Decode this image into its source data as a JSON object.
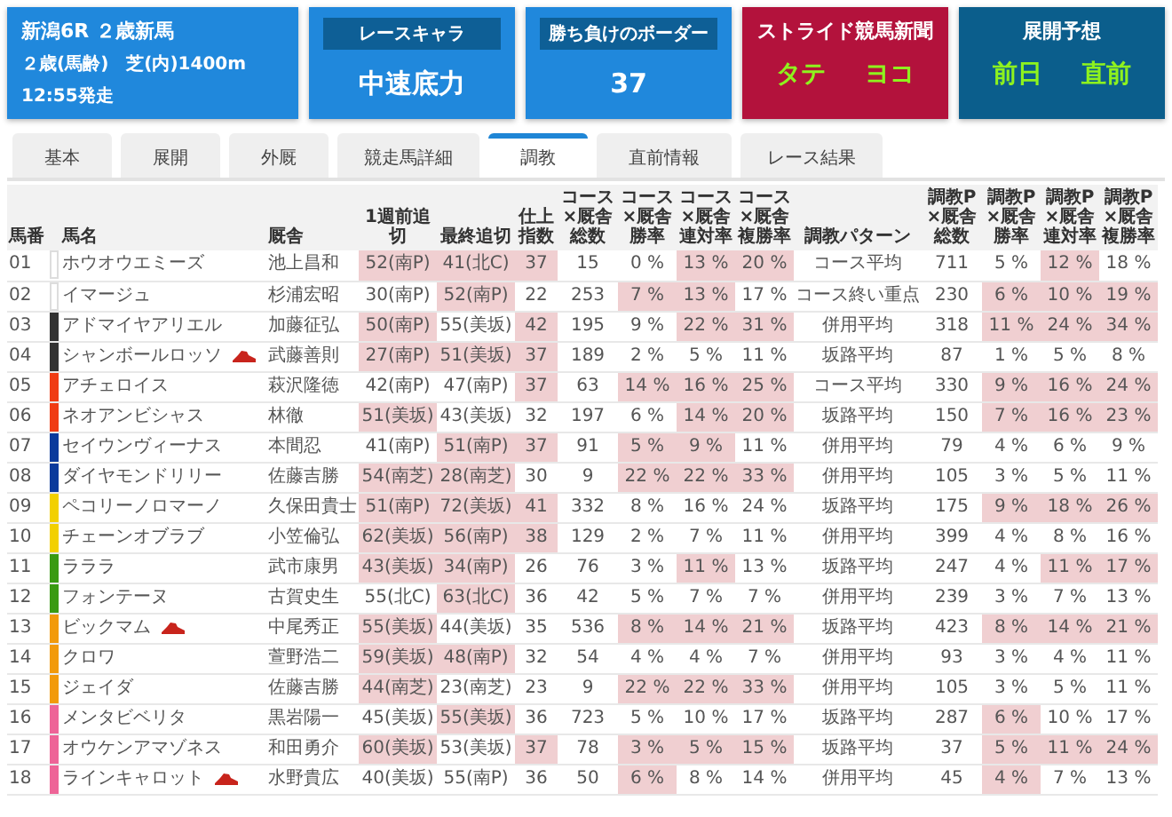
{
  "header_cards": [
    {
      "kind": "race",
      "color": "#2088dc",
      "title": "新潟6R ２歳新馬",
      "details": [
        "２歳(馬齢)",
        "芝(内)1400m"
      ],
      "time": "12:55発走"
    },
    {
      "kind": "metric",
      "color": "#2088dc",
      "label": "レースキャラ",
      "value": "中速底力"
    },
    {
      "kind": "metric",
      "color": "#2088dc",
      "label": "勝ち負けのボーダー",
      "value": "37"
    },
    {
      "kind": "pair",
      "color": "#b3123c",
      "title": "ストライド競馬新聞",
      "values": [
        "タテ",
        "ヨコ"
      ]
    },
    {
      "kind": "pair",
      "color": "#0b5e8c",
      "title": "展開予想",
      "values": [
        "前日",
        "直前"
      ]
    }
  ],
  "tabs": [
    {
      "label": "基本",
      "selected": false
    },
    {
      "label": "展開",
      "selected": false
    },
    {
      "label": "外厩",
      "selected": false
    },
    {
      "label": "競走馬詳細",
      "selected": false
    },
    {
      "label": "調教",
      "selected": true
    },
    {
      "label": "直前情報",
      "selected": false
    },
    {
      "label": "レース結果",
      "selected": false
    }
  ],
  "table": {
    "columns": [
      "馬番",
      "馬名",
      "厩舎",
      "1週前追切",
      "最終追切",
      "仕上指数",
      "コース×厩舎総数",
      "コース×厩舎勝率",
      "コース×厩舎連対率",
      "コース×厩舎複勝率",
      "調教パターン",
      "調教P×厩舎総数",
      "調教P×厩舎勝率",
      "調教P×厩舎連対率",
      "調教P×厩舎複勝率"
    ],
    "rows": [
      {
        "color": "#ffffff",
        "flagged": false,
        "cells": [
          {
            "text": "01",
            "highlighted": false
          },
          {
            "text": "ホウオウエミーズ",
            "highlighted": false
          },
          {
            "text": "池上昌和",
            "highlighted": false
          },
          {
            "text": "52(南P)",
            "highlighted": true
          },
          {
            "text": "41(北C)",
            "highlighted": true
          },
          {
            "text": "37",
            "highlighted": true
          },
          {
            "text": "15",
            "highlighted": false
          },
          {
            "text": "0 %",
            "highlighted": false
          },
          {
            "text": "13 %",
            "highlighted": true
          },
          {
            "text": "20 %",
            "highlighted": true
          },
          {
            "text": "コース平均",
            "highlighted": false
          },
          {
            "text": "711",
            "highlighted": false
          },
          {
            "text": "5 %",
            "highlighted": false
          },
          {
            "text": "12 %",
            "highlighted": true
          },
          {
            "text": "18 %",
            "highlighted": false
          }
        ]
      },
      {
        "color": "#ffffff",
        "flagged": false,
        "cells": [
          {
            "text": "02",
            "highlighted": false
          },
          {
            "text": "イマージュ",
            "highlighted": false
          },
          {
            "text": "杉浦宏昭",
            "highlighted": false
          },
          {
            "text": "30(南P)",
            "highlighted": false
          },
          {
            "text": "52(南P)",
            "highlighted": true
          },
          {
            "text": "22",
            "highlighted": false
          },
          {
            "text": "253",
            "highlighted": false
          },
          {
            "text": "7 %",
            "highlighted": true
          },
          {
            "text": "13 %",
            "highlighted": true
          },
          {
            "text": "17 %",
            "highlighted": false
          },
          {
            "text": "コース終い重点",
            "highlighted": false
          },
          {
            "text": "230",
            "highlighted": false
          },
          {
            "text": "6 %",
            "highlighted": true
          },
          {
            "text": "10 %",
            "highlighted": true
          },
          {
            "text": "19 %",
            "highlighted": true
          }
        ]
      },
      {
        "color": "#333333",
        "flagged": false,
        "cells": [
          {
            "text": "03",
            "highlighted": false
          },
          {
            "text": "アドマイヤアリエル",
            "highlighted": false
          },
          {
            "text": "加藤征弘",
            "highlighted": false
          },
          {
            "text": "50(南P)",
            "highlighted": true
          },
          {
            "text": "55(美坂)",
            "highlighted": false
          },
          {
            "text": "42",
            "highlighted": true
          },
          {
            "text": "195",
            "highlighted": false
          },
          {
            "text": "9 %",
            "highlighted": false
          },
          {
            "text": "22 %",
            "highlighted": true
          },
          {
            "text": "31 %",
            "highlighted": true
          },
          {
            "text": "併用平均",
            "highlighted": false
          },
          {
            "text": "318",
            "highlighted": false
          },
          {
            "text": "11 %",
            "highlighted": true
          },
          {
            "text": "24 %",
            "highlighted": true
          },
          {
            "text": "34 %",
            "highlighted": true
          }
        ]
      },
      {
        "color": "#333333",
        "flagged": true,
        "cells": [
          {
            "text": "04",
            "highlighted": false
          },
          {
            "text": "シャンボールロッソ",
            "highlighted": false
          },
          {
            "text": "武藤善則",
            "highlighted": false
          },
          {
            "text": "27(南P)",
            "highlighted": true
          },
          {
            "text": "51(美坂)",
            "highlighted": true
          },
          {
            "text": "37",
            "highlighted": true
          },
          {
            "text": "189",
            "highlighted": false
          },
          {
            "text": "2 %",
            "highlighted": false
          },
          {
            "text": "5 %",
            "highlighted": false
          },
          {
            "text": "11 %",
            "highlighted": false
          },
          {
            "text": "坂路平均",
            "highlighted": false
          },
          {
            "text": "87",
            "highlighted": false
          },
          {
            "text": "1 %",
            "highlighted": false
          },
          {
            "text": "5 %",
            "highlighted": false
          },
          {
            "text": "8 %",
            "highlighted": false
          }
        ]
      },
      {
        "color": "#f03c14",
        "flagged": false,
        "cells": [
          {
            "text": "05",
            "highlighted": false
          },
          {
            "text": "アチェロイス",
            "highlighted": false
          },
          {
            "text": "萩沢隆徳",
            "highlighted": false
          },
          {
            "text": "42(南P)",
            "highlighted": false
          },
          {
            "text": "47(南P)",
            "highlighted": false
          },
          {
            "text": "37",
            "highlighted": true
          },
          {
            "text": "63",
            "highlighted": false
          },
          {
            "text": "14 %",
            "highlighted": true
          },
          {
            "text": "16 %",
            "highlighted": true
          },
          {
            "text": "25 %",
            "highlighted": true
          },
          {
            "text": "コース平均",
            "highlighted": false
          },
          {
            "text": "330",
            "highlighted": false
          },
          {
            "text": "9 %",
            "highlighted": true
          },
          {
            "text": "16 %",
            "highlighted": true
          },
          {
            "text": "24 %",
            "highlighted": true
          }
        ]
      },
      {
        "color": "#f03c14",
        "flagged": false,
        "cells": [
          {
            "text": "06",
            "highlighted": false
          },
          {
            "text": "ネオアンビシャス",
            "highlighted": false
          },
          {
            "text": "林徹",
            "highlighted": false
          },
          {
            "text": "51(美坂)",
            "highlighted": true
          },
          {
            "text": "43(美坂)",
            "highlighted": false
          },
          {
            "text": "32",
            "highlighted": false
          },
          {
            "text": "197",
            "highlighted": false
          },
          {
            "text": "6 %",
            "highlighted": false
          },
          {
            "text": "14 %",
            "highlighted": true
          },
          {
            "text": "20 %",
            "highlighted": true
          },
          {
            "text": "坂路平均",
            "highlighted": false
          },
          {
            "text": "150",
            "highlighted": false
          },
          {
            "text": "7 %",
            "highlighted": true
          },
          {
            "text": "16 %",
            "highlighted": true
          },
          {
            "text": "23 %",
            "highlighted": true
          }
        ]
      },
      {
        "color": "#0b3a9c",
        "flagged": false,
        "cells": [
          {
            "text": "07",
            "highlighted": false
          },
          {
            "text": "セイウンヴィーナス",
            "highlighted": false
          },
          {
            "text": "本間忍",
            "highlighted": false
          },
          {
            "text": "41(南P)",
            "highlighted": false
          },
          {
            "text": "51(南P)",
            "highlighted": true
          },
          {
            "text": "37",
            "highlighted": true
          },
          {
            "text": "91",
            "highlighted": false
          },
          {
            "text": "5 %",
            "highlighted": true
          },
          {
            "text": "9 %",
            "highlighted": true
          },
          {
            "text": "11 %",
            "highlighted": false
          },
          {
            "text": "併用平均",
            "highlighted": false
          },
          {
            "text": "79",
            "highlighted": false
          },
          {
            "text": "4 %",
            "highlighted": false
          },
          {
            "text": "6 %",
            "highlighted": false
          },
          {
            "text": "9 %",
            "highlighted": false
          }
        ]
      },
      {
        "color": "#0b3a9c",
        "flagged": false,
        "cells": [
          {
            "text": "08",
            "highlighted": false
          },
          {
            "text": "ダイヤモンドリリー",
            "highlighted": false
          },
          {
            "text": "佐藤吉勝",
            "highlighted": false
          },
          {
            "text": "54(南芝)",
            "highlighted": true
          },
          {
            "text": "28(南芝)",
            "highlighted": true
          },
          {
            "text": "30",
            "highlighted": false
          },
          {
            "text": "9",
            "highlighted": false
          },
          {
            "text": "22 %",
            "highlighted": true
          },
          {
            "text": "22 %",
            "highlighted": true
          },
          {
            "text": "33 %",
            "highlighted": true
          },
          {
            "text": "併用平均",
            "highlighted": false
          },
          {
            "text": "105",
            "highlighted": false
          },
          {
            "text": "3 %",
            "highlighted": false
          },
          {
            "text": "5 %",
            "highlighted": false
          },
          {
            "text": "11 %",
            "highlighted": false
          }
        ]
      },
      {
        "color": "#f2d000",
        "flagged": false,
        "cells": [
          {
            "text": "09",
            "highlighted": false
          },
          {
            "text": "ペコリーノロマーノ",
            "highlighted": false
          },
          {
            "text": "久保田貴士",
            "highlighted": false
          },
          {
            "text": "51(南P)",
            "highlighted": true
          },
          {
            "text": "72(美坂)",
            "highlighted": true
          },
          {
            "text": "41",
            "highlighted": true
          },
          {
            "text": "332",
            "highlighted": false
          },
          {
            "text": "8 %",
            "highlighted": false
          },
          {
            "text": "16 %",
            "highlighted": false
          },
          {
            "text": "24 %",
            "highlighted": false
          },
          {
            "text": "坂路平均",
            "highlighted": false
          },
          {
            "text": "175",
            "highlighted": false
          },
          {
            "text": "9 %",
            "highlighted": true
          },
          {
            "text": "18 %",
            "highlighted": true
          },
          {
            "text": "26 %",
            "highlighted": true
          }
        ]
      },
      {
        "color": "#f2d000",
        "flagged": false,
        "cells": [
          {
            "text": "10",
            "highlighted": false
          },
          {
            "text": "チェーンオブラブ",
            "highlighted": false
          },
          {
            "text": "小笠倫弘",
            "highlighted": false
          },
          {
            "text": "62(美坂)",
            "highlighted": true
          },
          {
            "text": "56(南P)",
            "highlighted": true
          },
          {
            "text": "38",
            "highlighted": true
          },
          {
            "text": "129",
            "highlighted": false
          },
          {
            "text": "2 %",
            "highlighted": false
          },
          {
            "text": "7 %",
            "highlighted": false
          },
          {
            "text": "11 %",
            "highlighted": false
          },
          {
            "text": "併用平均",
            "highlighted": false
          },
          {
            "text": "399",
            "highlighted": false
          },
          {
            "text": "4 %",
            "highlighted": false
          },
          {
            "text": "8 %",
            "highlighted": false
          },
          {
            "text": "16 %",
            "highlighted": false
          }
        ]
      },
      {
        "color": "#3a9a12",
        "flagged": false,
        "cells": [
          {
            "text": "11",
            "highlighted": false
          },
          {
            "text": "ラララ",
            "highlighted": false
          },
          {
            "text": "武市康男",
            "highlighted": false
          },
          {
            "text": "43(美坂)",
            "highlighted": true
          },
          {
            "text": "34(南P)",
            "highlighted": true
          },
          {
            "text": "26",
            "highlighted": false
          },
          {
            "text": "76",
            "highlighted": false
          },
          {
            "text": "3 %",
            "highlighted": false
          },
          {
            "text": "11 %",
            "highlighted": true
          },
          {
            "text": "13 %",
            "highlighted": false
          },
          {
            "text": "坂路平均",
            "highlighted": false
          },
          {
            "text": "247",
            "highlighted": false
          },
          {
            "text": "4 %",
            "highlighted": false
          },
          {
            "text": "11 %",
            "highlighted": true
          },
          {
            "text": "17 %",
            "highlighted": true
          }
        ]
      },
      {
        "color": "#3a9a12",
        "flagged": false,
        "cells": [
          {
            "text": "12",
            "highlighted": false
          },
          {
            "text": "フォンテーヌ",
            "highlighted": false
          },
          {
            "text": "古賀史生",
            "highlighted": false
          },
          {
            "text": "55(北C)",
            "highlighted": false
          },
          {
            "text": "63(北C)",
            "highlighted": true
          },
          {
            "text": "36",
            "highlighted": false
          },
          {
            "text": "42",
            "highlighted": false
          },
          {
            "text": "5 %",
            "highlighted": false
          },
          {
            "text": "7 %",
            "highlighted": false
          },
          {
            "text": "7 %",
            "highlighted": false
          },
          {
            "text": "併用平均",
            "highlighted": false
          },
          {
            "text": "239",
            "highlighted": false
          },
          {
            "text": "3 %",
            "highlighted": false
          },
          {
            "text": "7 %",
            "highlighted": false
          },
          {
            "text": "13 %",
            "highlighted": false
          }
        ]
      },
      {
        "color": "#f29a0a",
        "flagged": true,
        "cells": [
          {
            "text": "13",
            "highlighted": false
          },
          {
            "text": "ビックマム",
            "highlighted": false
          },
          {
            "text": "中尾秀正",
            "highlighted": false
          },
          {
            "text": "55(美坂)",
            "highlighted": true
          },
          {
            "text": "44(美坂)",
            "highlighted": false
          },
          {
            "text": "35",
            "highlighted": false
          },
          {
            "text": "536",
            "highlighted": false
          },
          {
            "text": "8 %",
            "highlighted": true
          },
          {
            "text": "14 %",
            "highlighted": true
          },
          {
            "text": "21 %",
            "highlighted": true
          },
          {
            "text": "坂路平均",
            "highlighted": false
          },
          {
            "text": "423",
            "highlighted": false
          },
          {
            "text": "8 %",
            "highlighted": true
          },
          {
            "text": "14 %",
            "highlighted": true
          },
          {
            "text": "21 %",
            "highlighted": true
          }
        ]
      },
      {
        "color": "#f29a0a",
        "flagged": false,
        "cells": [
          {
            "text": "14",
            "highlighted": false
          },
          {
            "text": "クロワ",
            "highlighted": false
          },
          {
            "text": "萱野浩二",
            "highlighted": false
          },
          {
            "text": "59(美坂)",
            "highlighted": true
          },
          {
            "text": "48(南P)",
            "highlighted": true
          },
          {
            "text": "32",
            "highlighted": false
          },
          {
            "text": "54",
            "highlighted": false
          },
          {
            "text": "4 %",
            "highlighted": false
          },
          {
            "text": "4 %",
            "highlighted": false
          },
          {
            "text": "7 %",
            "highlighted": false
          },
          {
            "text": "併用平均",
            "highlighted": false
          },
          {
            "text": "93",
            "highlighted": false
          },
          {
            "text": "3 %",
            "highlighted": false
          },
          {
            "text": "4 %",
            "highlighted": false
          },
          {
            "text": "11 %",
            "highlighted": false
          }
        ]
      },
      {
        "color": "#f29a0a",
        "flagged": false,
        "cells": [
          {
            "text": "15",
            "highlighted": false
          },
          {
            "text": "ジェイダ",
            "highlighted": false
          },
          {
            "text": "佐藤吉勝",
            "highlighted": false
          },
          {
            "text": "44(南芝)",
            "highlighted": true
          },
          {
            "text": "23(南芝)",
            "highlighted": false
          },
          {
            "text": "23",
            "highlighted": false
          },
          {
            "text": "9",
            "highlighted": false
          },
          {
            "text": "22 %",
            "highlighted": true
          },
          {
            "text": "22 %",
            "highlighted": true
          },
          {
            "text": "33 %",
            "highlighted": true
          },
          {
            "text": "併用平均",
            "highlighted": false
          },
          {
            "text": "105",
            "highlighted": false
          },
          {
            "text": "3 %",
            "highlighted": false
          },
          {
            "text": "5 %",
            "highlighted": false
          },
          {
            "text": "11 %",
            "highlighted": false
          }
        ]
      },
      {
        "color": "#ee6497",
        "flagged": false,
        "cells": [
          {
            "text": "16",
            "highlighted": false
          },
          {
            "text": "メンタビベリタ",
            "highlighted": false
          },
          {
            "text": "黒岩陽一",
            "highlighted": false
          },
          {
            "text": "45(美坂)",
            "highlighted": false
          },
          {
            "text": "55(美坂)",
            "highlighted": true
          },
          {
            "text": "36",
            "highlighted": false
          },
          {
            "text": "723",
            "highlighted": false
          },
          {
            "text": "5 %",
            "highlighted": false
          },
          {
            "text": "10 %",
            "highlighted": false
          },
          {
            "text": "17 %",
            "highlighted": false
          },
          {
            "text": "坂路平均",
            "highlighted": false
          },
          {
            "text": "287",
            "highlighted": false
          },
          {
            "text": "6 %",
            "highlighted": true
          },
          {
            "text": "10 %",
            "highlighted": false
          },
          {
            "text": "17 %",
            "highlighted": false
          }
        ]
      },
      {
        "color": "#ee6497",
        "flagged": false,
        "cells": [
          {
            "text": "17",
            "highlighted": false
          },
          {
            "text": "オウケンアマゾネス",
            "highlighted": false
          },
          {
            "text": "和田勇介",
            "highlighted": false
          },
          {
            "text": "60(美坂)",
            "highlighted": true
          },
          {
            "text": "53(美坂)",
            "highlighted": false
          },
          {
            "text": "37",
            "highlighted": true
          },
          {
            "text": "78",
            "highlighted": false
          },
          {
            "text": "3 %",
            "highlighted": true
          },
          {
            "text": "5 %",
            "highlighted": true
          },
          {
            "text": "15 %",
            "highlighted": true
          },
          {
            "text": "坂路平均",
            "highlighted": false
          },
          {
            "text": "37",
            "highlighted": false
          },
          {
            "text": "5 %",
            "highlighted": true
          },
          {
            "text": "11 %",
            "highlighted": true
          },
          {
            "text": "24 %",
            "highlighted": true
          }
        ]
      },
      {
        "color": "#ee6497",
        "flagged": true,
        "cells": [
          {
            "text": "18",
            "highlighted": false
          },
          {
            "text": "ラインキャロット",
            "highlighted": false
          },
          {
            "text": "水野貴広",
            "highlighted": false
          },
          {
            "text": "40(美坂)",
            "highlighted": false
          },
          {
            "text": "55(南P)",
            "highlighted": false
          },
          {
            "text": "36",
            "highlighted": false
          },
          {
            "text": "50",
            "highlighted": false
          },
          {
            "text": "6 %",
            "highlighted": true
          },
          {
            "text": "8 %",
            "highlighted": false
          },
          {
            "text": "14 %",
            "highlighted": false
          },
          {
            "text": "併用平均",
            "highlighted": false
          },
          {
            "text": "45",
            "highlighted": false
          },
          {
            "text": "4 %",
            "highlighted": true
          },
          {
            "text": "7 %",
            "highlighted": false
          },
          {
            "text": "13 %",
            "highlighted": false
          }
        ]
      }
    ]
  }
}
